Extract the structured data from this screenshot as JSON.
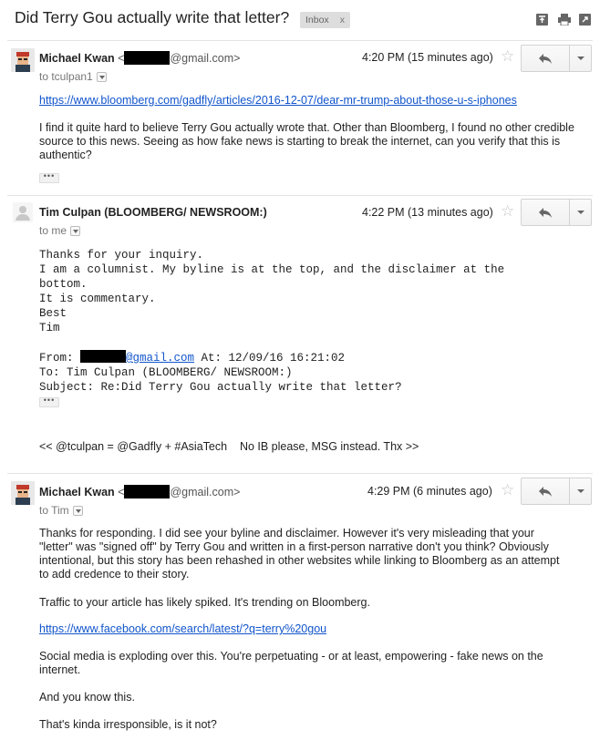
{
  "thread": {
    "subject": "Did Terry Gou actually write that letter?",
    "label": "Inbox",
    "label_close": "x"
  },
  "messages": [
    {
      "sender_name": "Michael Kwan",
      "sender_email_prefix": "<",
      "sender_email_suffix": "@gmail.com>",
      "to": "to tculpan1",
      "time": "4:20 PM (15 minutes ago)",
      "link": "https://www.bloomberg.com/gadfly/articles/2016-12-07/dear-mr-trump-about-those-u-s-iphones",
      "paragraph": "I find it quite hard to believe Terry Gou actually wrote that. Other than Bloomberg, I found no other credible source to this news. Seeing as how fake news is starting to break the internet, can you verify that this is authentic?"
    },
    {
      "sender_name": "Tim Culpan (BLOOMBERG/ NEWSROOM:)",
      "to": "to me",
      "time": "4:22 PM (13 minutes ago)",
      "lines": [
        "Thanks for your inquiry.",
        "I am a columnist. My byline is at the top, and the disclaimer at the",
        "bottom.",
        "It is commentary.",
        "Best",
        "Tim"
      ],
      "quoted_from_label": "From: ",
      "quoted_from_email": "@gmail.com",
      "quoted_from_at": " At: 12/09/16 16:21:02",
      "quoted_to": "To: Tim Culpan (BLOOMBERG/ NEWSROOM:)",
      "quoted_subject": "Subject: Re:Did Terry Gou actually write that letter?",
      "signature": "<< @tculpan = @Gadfly + #AsiaTech    No IB please, MSG instead. Thx >>"
    },
    {
      "sender_name": "Michael Kwan",
      "sender_email_prefix": "<",
      "sender_email_suffix": "@gmail.com>",
      "to": "to Tim",
      "time": "4:29 PM (6 minutes ago)",
      "p1": "Thanks for responding. I did see your byline and disclaimer. However it's very misleading that your \"letter\" was \"signed off\" by Terry Gou and written in a first-person narrative don't you think? Obviously intentional, but this story has been rehashed in other websites while linking to Bloomberg as an attempt to add credence to their story.",
      "p2": "Traffic to your article has likely spiked. It's trending on Bloomberg.",
      "link": "https://www.facebook.com/search/latest/?q=terry%20gou",
      "p3": "Social media is exploding over this. You're perpetuating - or at least, empowering - fake news on the internet.",
      "p4": "And you know this.",
      "p5": "That's kinda irresponsible, is it not?"
    }
  ],
  "ui": {
    "ellipsis": "•••",
    "star": "☆"
  }
}
